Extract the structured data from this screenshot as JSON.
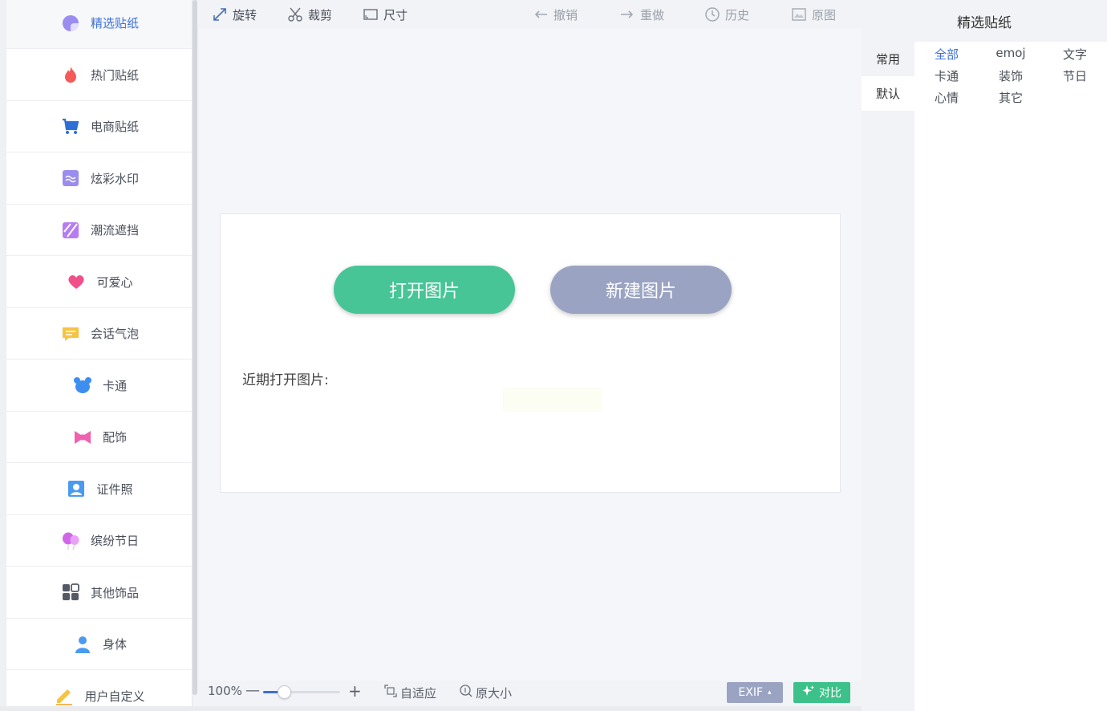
{
  "sidebar": {
    "items": [
      {
        "label": "精选贴纸",
        "icon": "sticker-icon",
        "color": "#9b8cf0",
        "active": true
      },
      {
        "label": "热门贴纸",
        "icon": "flame-icon",
        "color": "#f45a5a"
      },
      {
        "label": "电商贴纸",
        "icon": "cart-icon",
        "color": "#2e6fd6"
      },
      {
        "label": "炫彩水印",
        "icon": "watermark-icon",
        "color": "#9b8cf0"
      },
      {
        "label": "潮流遮挡",
        "icon": "mask-icon",
        "color": "#b77cf2"
      },
      {
        "label": "可爱心",
        "icon": "heart-icon",
        "color": "#f0508a"
      },
      {
        "label": "会话气泡",
        "icon": "speech-bubble-icon",
        "color": "#f6c342"
      },
      {
        "label": "卡通",
        "icon": "bear-icon",
        "color": "#3d8ef0"
      },
      {
        "label": "配饰",
        "icon": "bow-icon",
        "color": "#f060b0"
      },
      {
        "label": "证件照",
        "icon": "id-photo-icon",
        "color": "#4b9af0"
      },
      {
        "label": "缤纷节日",
        "icon": "balloon-icon",
        "color": "#d066e8"
      },
      {
        "label": "其他饰品",
        "icon": "grid-icon",
        "color": "#555b66"
      },
      {
        "label": "身体",
        "icon": "person-icon",
        "color": "#4b9af0"
      },
      {
        "label": "用户自定义",
        "icon": "pencil-icon",
        "color": "#f6c342"
      }
    ]
  },
  "toolbar": {
    "rotate": "旋转",
    "crop": "裁剪",
    "resize": "尺寸",
    "undo": "撤销",
    "redo": "重做",
    "history": "历史",
    "original": "原图"
  },
  "canvas": {
    "open_button": "打开图片",
    "new_button": "新建图片",
    "recent_label": "近期打开图片:"
  },
  "bottombar": {
    "zoom_label": "100%",
    "zoom_minus": "—",
    "zoom_plus": "+",
    "zoom_fraction": 0.27,
    "fit": "自适应",
    "actual_size": "原大小",
    "exif": "EXIF",
    "exif_caret": "▴",
    "compare": "对比"
  },
  "right_panel": {
    "title": "精选贴纸",
    "tabs": [
      {
        "label": "常用",
        "active": false
      },
      {
        "label": "默认",
        "active": true
      }
    ],
    "categories": [
      {
        "label": "全部",
        "active": true
      },
      {
        "label": "emoj"
      },
      {
        "label": "文字"
      },
      {
        "label": "卡通"
      },
      {
        "label": "装饰"
      },
      {
        "label": "节日"
      },
      {
        "label": "心情"
      },
      {
        "label": "其它"
      }
    ]
  },
  "colors": {
    "accent_blue": "#3b6fd8",
    "open_green": "#47c596",
    "new_gray_blue": "#9aa3c2",
    "compare_green": "#3dc18a"
  }
}
